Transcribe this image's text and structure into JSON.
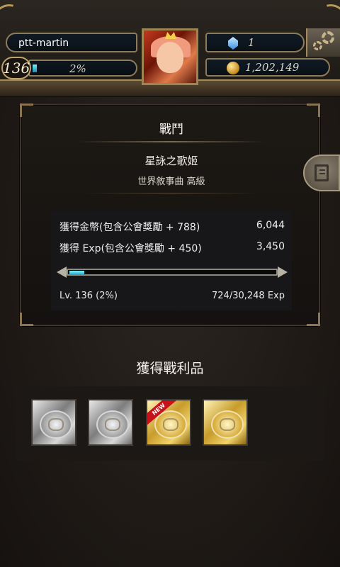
{
  "header": {
    "player_name": "ptt-martin",
    "level": "136",
    "exp_percent_label": "2%",
    "exp_progress": 0.02,
    "gems": "1",
    "gold": "1,202,149"
  },
  "battle": {
    "title": "戰鬥",
    "quest_name": "星詠之歌姬",
    "quest_subtitle": "世界敘事曲 高級",
    "rewards": [
      {
        "label": "獲得金幣(包含公會獎勵 + 788)",
        "value": "6,044"
      },
      {
        "label": "獲得 Exp(包含公會獎勵 + 450)",
        "value": "3,450"
      }
    ],
    "exp_bar_progress": 0.024,
    "level_label": "Lv. 136 (2%)",
    "exp_label": "724/30,248 Exp"
  },
  "loot": {
    "title": "獲得戰利品",
    "items": [
      {
        "type": "silver",
        "is_new": false
      },
      {
        "type": "silver",
        "is_new": false
      },
      {
        "type": "gold",
        "is_new": true,
        "badge": "NEW"
      },
      {
        "type": "gold",
        "is_new": false
      }
    ]
  },
  "icons": {
    "gem": "blue-crystal-icon",
    "gold": "gold-coin-icon",
    "settings": "gears-icon",
    "side_tab": "book-icon"
  }
}
